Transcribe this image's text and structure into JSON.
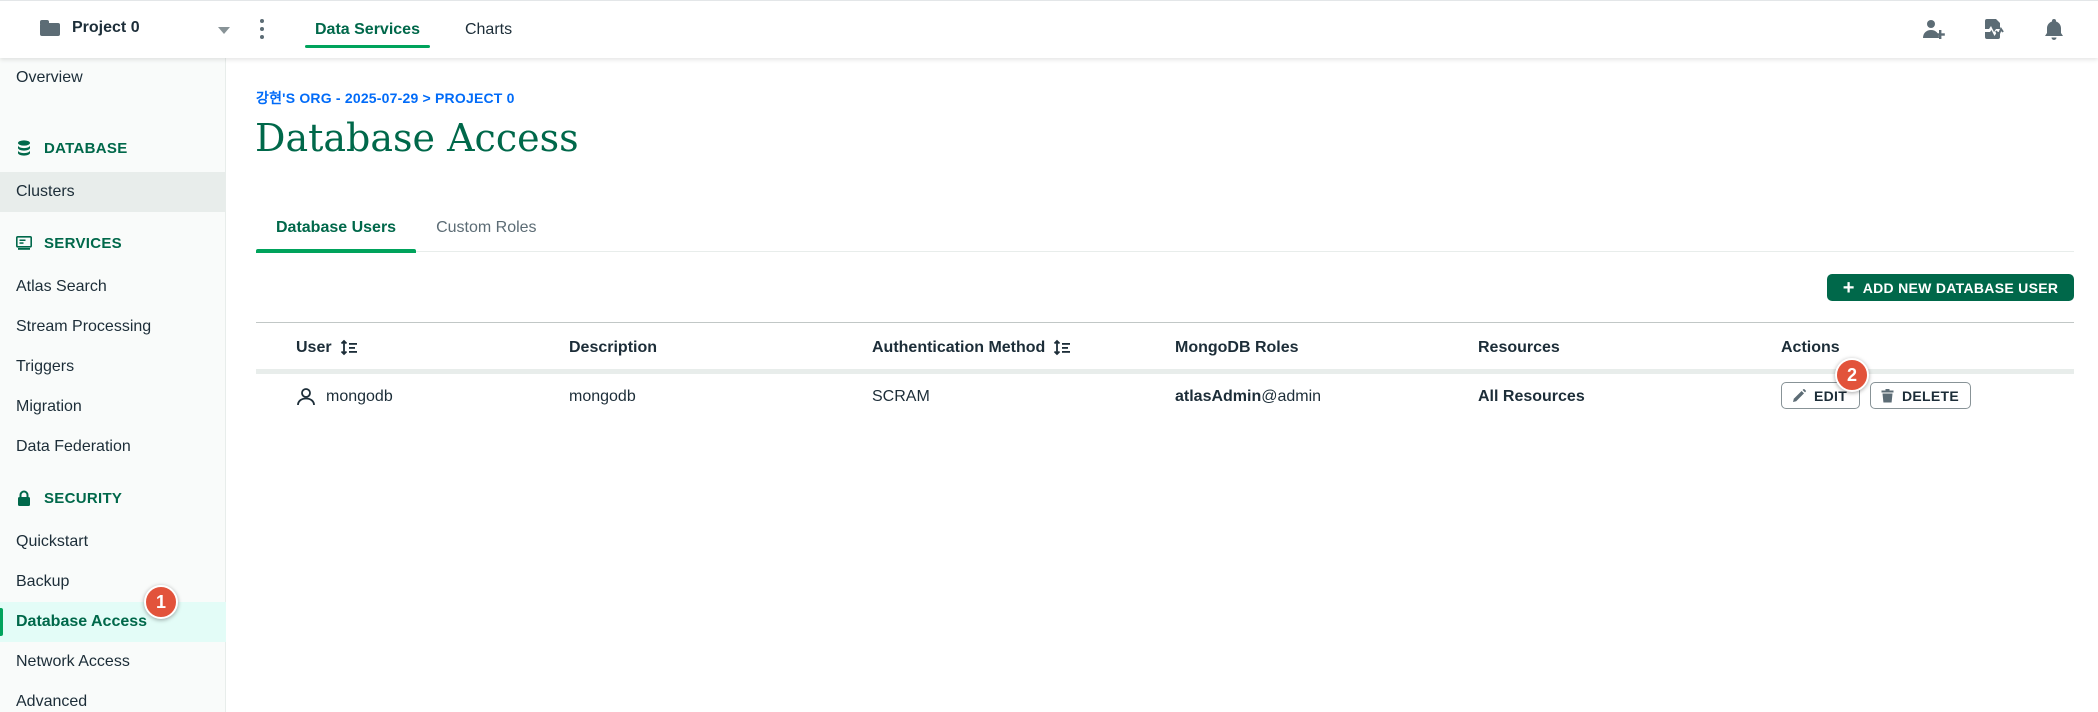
{
  "topbar": {
    "project_name": "Project 0",
    "tabs": [
      {
        "label": "Data Services",
        "active": true
      },
      {
        "label": "Charts",
        "active": false
      }
    ],
    "icons": [
      "add-user-icon",
      "activity-icon",
      "bell-icon"
    ]
  },
  "sidebar": {
    "overview": "Overview",
    "sections": [
      {
        "header": "DATABASE",
        "icon": "database-icon",
        "items": [
          "Clusters"
        ]
      },
      {
        "header": "SERVICES",
        "icon": "services-icon",
        "items": [
          "Atlas Search",
          "Stream Processing",
          "Triggers",
          "Migration",
          "Data Federation"
        ]
      },
      {
        "header": "SECURITY",
        "icon": "lock-icon",
        "items": [
          "Quickstart",
          "Backup",
          "Database Access",
          "Network Access",
          "Advanced"
        ]
      }
    ],
    "active_item": "Database Access"
  },
  "badges": {
    "one": "1",
    "two": "2"
  },
  "main": {
    "breadcrumb": "강현'S ORG - 2025-07-29 > PROJECT 0",
    "title": "Database Access",
    "tabs": [
      {
        "label": "Database Users",
        "active": true
      },
      {
        "label": "Custom Roles",
        "active": false
      }
    ],
    "add_button": "ADD NEW DATABASE USER",
    "table": {
      "columns": [
        "User",
        "Description",
        "Authentication Method",
        "MongoDB Roles",
        "Resources",
        "Actions"
      ],
      "rows": [
        {
          "user": "mongodb",
          "description": "mongodb",
          "auth_method": "SCRAM",
          "role_name": "atlasAdmin",
          "role_db": "@admin",
          "resources": "All Resources",
          "edit_label": "EDIT",
          "delete_label": "DELETE"
        }
      ]
    }
  },
  "colors": {
    "brand_green": "#00684a",
    "accent_green": "#00a35c",
    "link_blue": "#016bf8",
    "badge_red": "#e2533b"
  }
}
